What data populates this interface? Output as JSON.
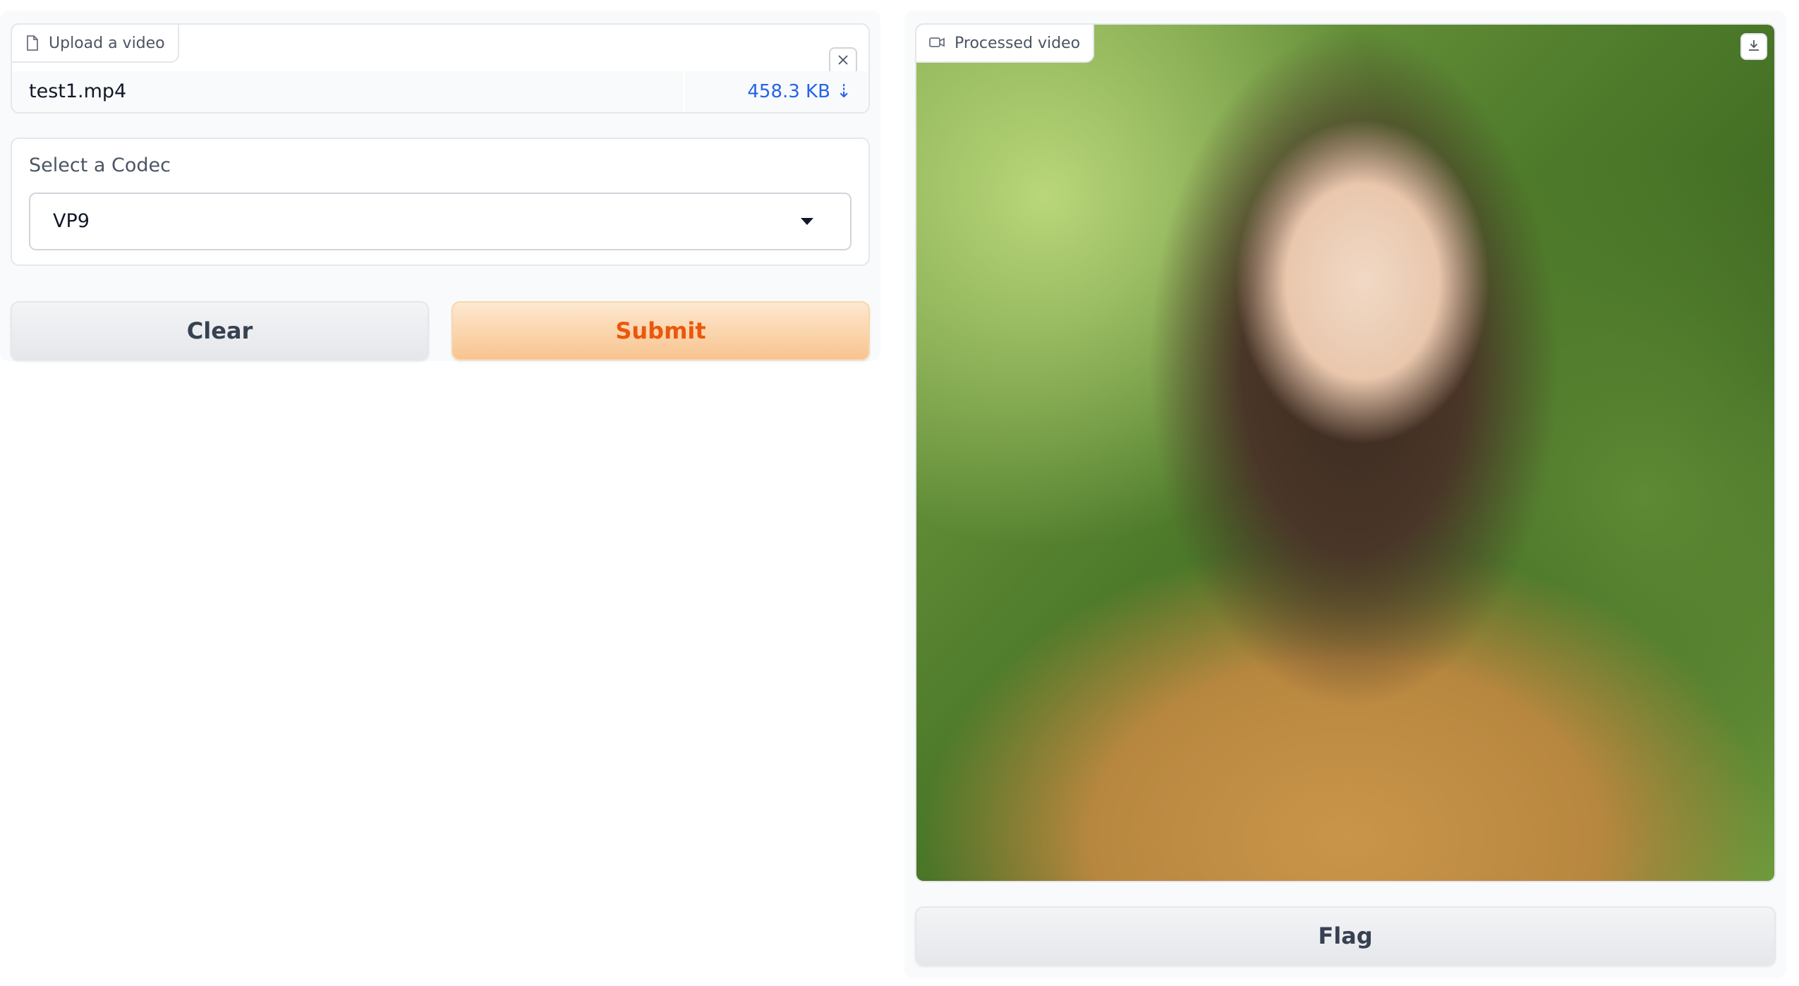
{
  "input": {
    "upload_label": "Upload a video",
    "file_name": "test1.mp4",
    "file_size": "458.3 KB ⇣",
    "codec_label": "Select a Codec",
    "codec_value": "VP9"
  },
  "actions": {
    "clear_label": "Clear",
    "submit_label": "Submit",
    "flag_label": "Flag"
  },
  "output": {
    "video_label": "Processed video"
  },
  "icons": {
    "file": "file-icon",
    "close": "close-icon",
    "dropdown": "chevron-down-icon",
    "video": "video-icon",
    "download": "download-icon"
  },
  "colors": {
    "submit_text": "#ea580c",
    "submit_bg": "#f8c48f",
    "file_size_link": "#2563eb",
    "neutral_button": "#e5e7eb"
  }
}
